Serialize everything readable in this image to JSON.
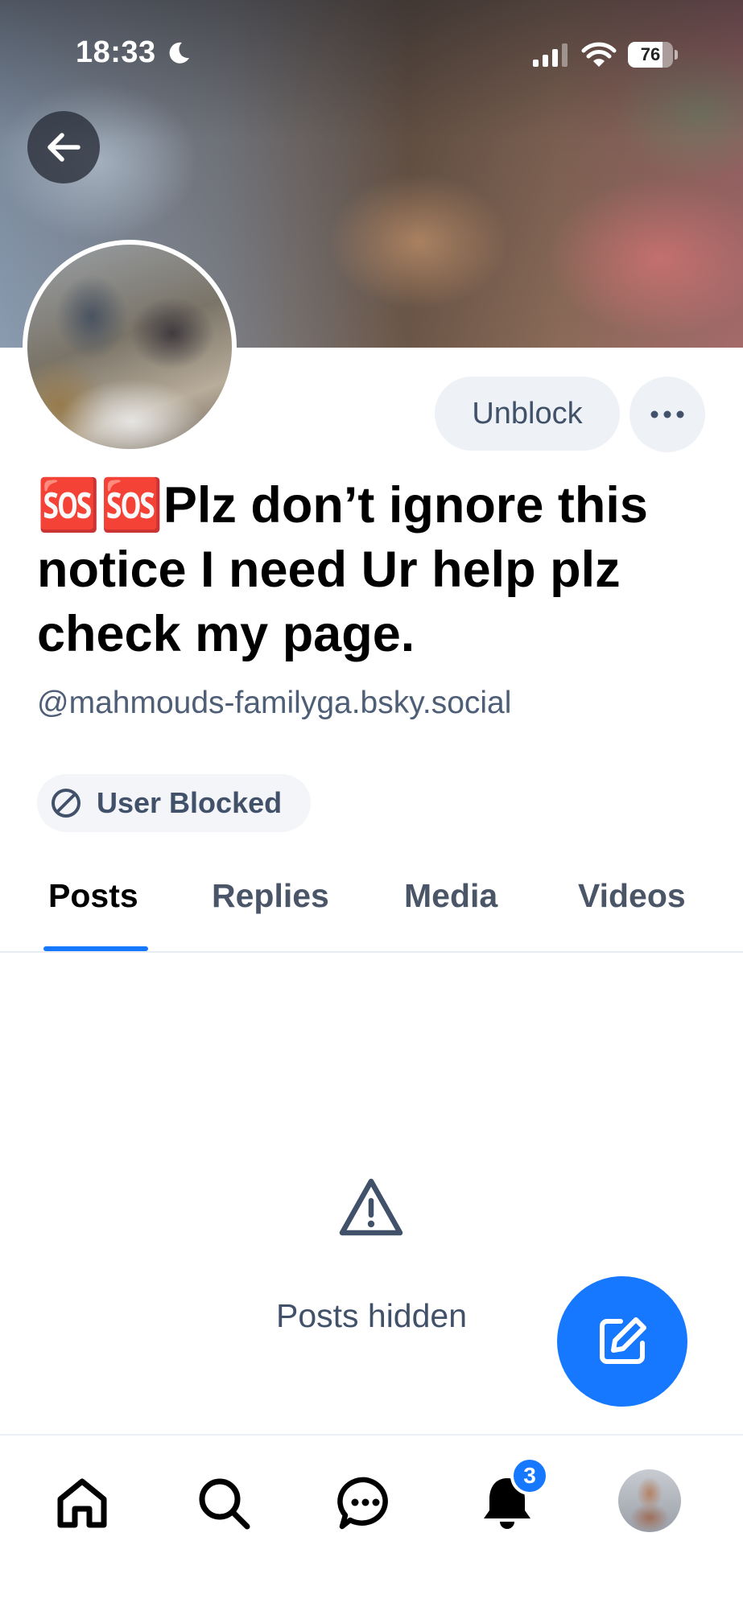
{
  "status_bar": {
    "time": "18:33",
    "battery": "76",
    "battery_level": 0.76
  },
  "profile": {
    "display_name": "🆘🆘Plz don’t ignore this notice I need Ur help plz check my page.",
    "handle": "@mahmouds-familyga.bsky.social",
    "blocked_label": "User Blocked"
  },
  "actions": {
    "unblock_label": "Unblock",
    "more_label": "•••"
  },
  "tabs": [
    {
      "label": "Posts",
      "active": true
    },
    {
      "label": "Replies",
      "active": false
    },
    {
      "label": "Media",
      "active": false
    },
    {
      "label": "Videos",
      "active": false
    }
  ],
  "empty_state": {
    "message": "Posts hidden"
  },
  "bottom_nav": {
    "items": [
      "home-icon",
      "search-icon",
      "chat-icon",
      "bell-icon",
      "profile-avatar"
    ],
    "notifications_badge": "3"
  },
  "colors": {
    "accent": "#1677ff",
    "muted_text": "#405169",
    "button_bg": "#eef1f6"
  }
}
